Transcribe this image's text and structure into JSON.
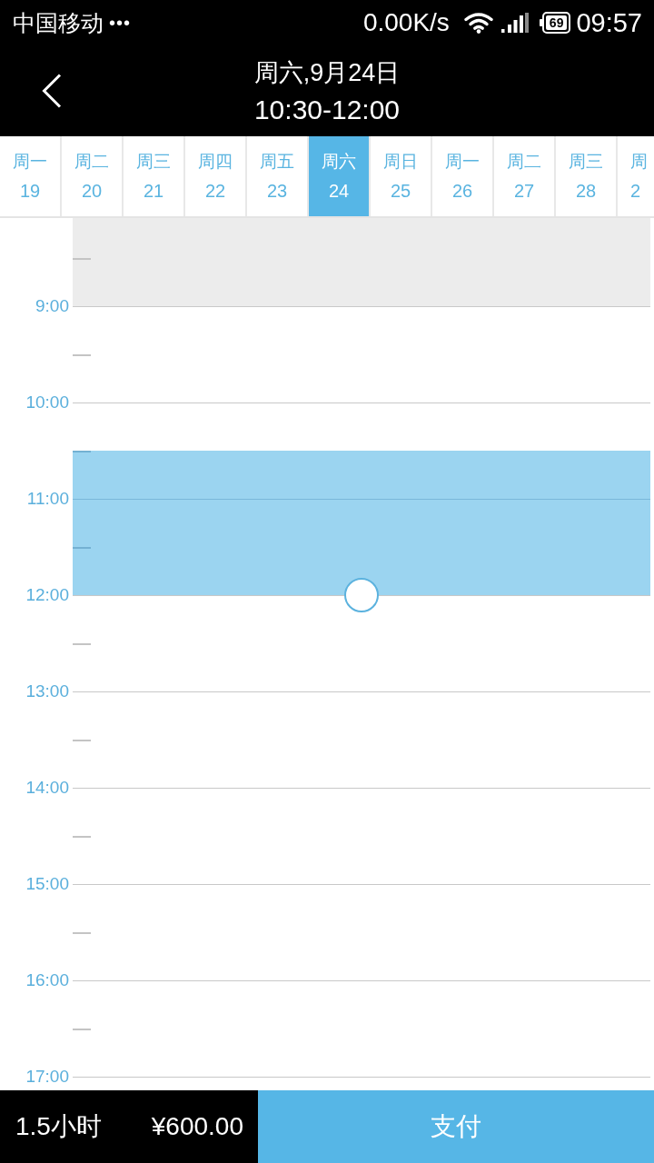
{
  "status_bar": {
    "carrier": "中国移动",
    "dots": "•••",
    "speed": "0.00K/s",
    "battery": "69",
    "time": "09:57"
  },
  "header": {
    "title": "周六,9月24日",
    "subtitle": "10:30-12:00"
  },
  "days": [
    {
      "weekday": "周一",
      "date": "19",
      "selected": false
    },
    {
      "weekday": "周二",
      "date": "20",
      "selected": false
    },
    {
      "weekday": "周三",
      "date": "21",
      "selected": false
    },
    {
      "weekday": "周四",
      "date": "22",
      "selected": false
    },
    {
      "weekday": "周五",
      "date": "23",
      "selected": false
    },
    {
      "weekday": "周六",
      "date": "24",
      "selected": true
    },
    {
      "weekday": "周日",
      "date": "25",
      "selected": false
    },
    {
      "weekday": "周一",
      "date": "26",
      "selected": false
    },
    {
      "weekday": "周二",
      "date": "27",
      "selected": false
    },
    {
      "weekday": "周三",
      "date": "28",
      "selected": false
    },
    {
      "weekday": "周",
      "date": "2",
      "selected": false
    }
  ],
  "timeline": {
    "hours": [
      {
        "slots": [
          {
            "disabled": true,
            "selected": false
          },
          {
            "disabled": true,
            "selected": false
          }
        ]
      },
      {
        "label": "9:00",
        "slots": [
          {
            "disabled": false,
            "selected": false
          },
          {
            "disabled": false,
            "selected": false
          }
        ]
      },
      {
        "label": "10:00",
        "slots": [
          {
            "disabled": false,
            "selected": false
          },
          {
            "disabled": false,
            "selected": true
          }
        ]
      },
      {
        "label": "11:00",
        "slots": [
          {
            "disabled": false,
            "selected": true
          },
          {
            "disabled": false,
            "selected": true
          }
        ]
      },
      {
        "label": "12:00",
        "slots": [
          {
            "disabled": false,
            "selected": false
          },
          {
            "disabled": false,
            "selected": false
          }
        ]
      },
      {
        "label": "13:00",
        "slots": [
          {
            "disabled": false,
            "selected": false
          },
          {
            "disabled": false,
            "selected": false
          }
        ]
      },
      {
        "label": "14:00",
        "slots": [
          {
            "disabled": false,
            "selected": false
          },
          {
            "disabled": false,
            "selected": false
          }
        ]
      },
      {
        "label": "15:00",
        "slots": [
          {
            "disabled": false,
            "selected": false
          },
          {
            "disabled": false,
            "selected": false
          }
        ]
      },
      {
        "label": "16:00",
        "slots": [
          {
            "disabled": false,
            "selected": false
          },
          {
            "disabled": false,
            "selected": false
          }
        ]
      },
      {
        "label": "17:00",
        "slots": [
          {
            "disabled": false,
            "selected": false
          }
        ]
      }
    ]
  },
  "footer": {
    "duration": "1.5小时",
    "price": "¥600.00",
    "pay_button": "支付"
  }
}
